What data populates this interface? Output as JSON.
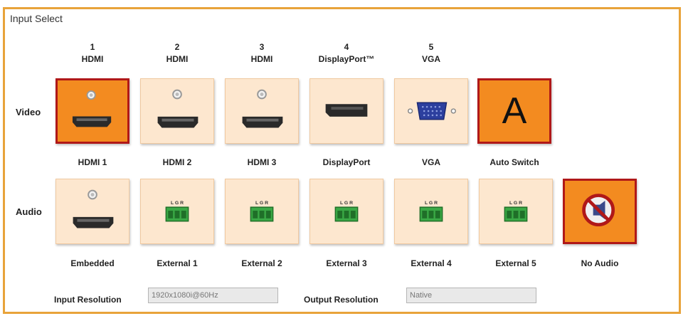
{
  "panel": {
    "title": "Input Select"
  },
  "inputs": [
    {
      "number": "1",
      "type": "HDMI"
    },
    {
      "number": "2",
      "type": "HDMI"
    },
    {
      "number": "3",
      "type": "HDMI"
    },
    {
      "number": "4",
      "type": "DisplayPort™"
    },
    {
      "number": "5",
      "type": "VGA"
    }
  ],
  "video": {
    "row_label": "Video",
    "buttons": [
      {
        "label": "HDMI 1",
        "icon": "hdmi-port-icon",
        "selected": true
      },
      {
        "label": "HDMI 2",
        "icon": "hdmi-port-icon",
        "selected": false
      },
      {
        "label": "HDMI 3",
        "icon": "hdmi-port-icon",
        "selected": false
      },
      {
        "label": "DisplayPort",
        "icon": "displayport-port-icon",
        "selected": false
      },
      {
        "label": "VGA",
        "icon": "vga-port-icon",
        "selected": false
      },
      {
        "label": "Auto Switch",
        "icon": "auto-switch-icon",
        "glyph": "A",
        "selected": true
      }
    ]
  },
  "audio": {
    "row_label": "Audio",
    "buttons": [
      {
        "label": "Embedded",
        "icon": "hdmi-port-icon",
        "selected": false
      },
      {
        "label": "External 1",
        "icon": "terminal-block-icon",
        "pins": "L G R",
        "selected": false
      },
      {
        "label": "External 2",
        "icon": "terminal-block-icon",
        "pins": "L G R",
        "selected": false
      },
      {
        "label": "External 3",
        "icon": "terminal-block-icon",
        "pins": "L G R",
        "selected": false
      },
      {
        "label": "External 4",
        "icon": "terminal-block-icon",
        "pins": "L G R",
        "selected": false
      },
      {
        "label": "External 5",
        "icon": "terminal-block-icon",
        "pins": "L G R",
        "selected": false
      },
      {
        "label": "No Audio",
        "icon": "no-audio-icon",
        "selected": true
      }
    ]
  },
  "resolution": {
    "input_label": "Input Resolution",
    "input_value": "1920x1080i@60Hz",
    "output_label": "Output Resolution",
    "output_value": "Native"
  },
  "colors": {
    "panel_border": "#e8a33a",
    "button_bg": "#fde7cf",
    "selected_bg": "#f38b20",
    "selected_border": "#b01818",
    "terminal_green": "#3aa845",
    "vga_blue": "#2c3f9e"
  }
}
